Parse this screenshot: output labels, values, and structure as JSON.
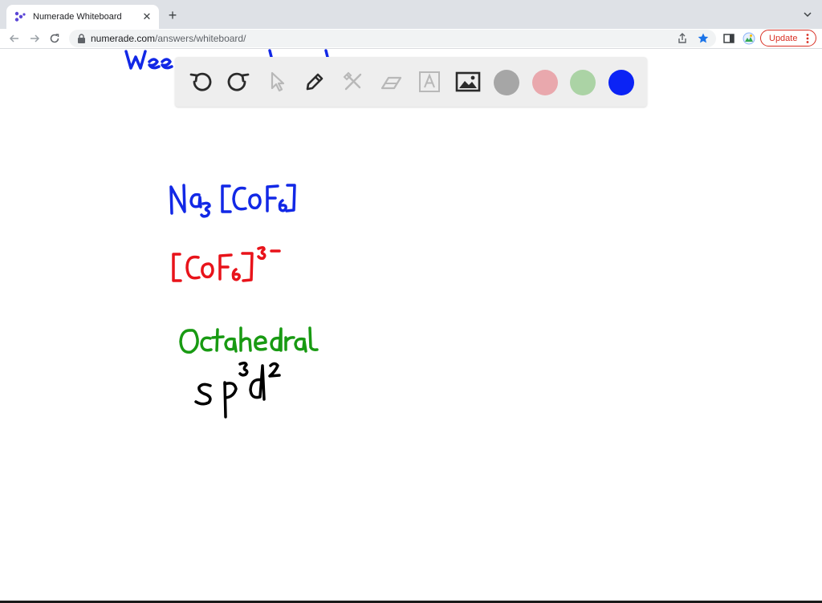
{
  "browser": {
    "tab": {
      "title": "Numerade Whiteboard"
    },
    "url": {
      "host": "numerade.com",
      "path": "/answers/whiteboard/"
    },
    "update_label": "Update"
  },
  "whiteboard": {
    "tools": [
      {
        "name": "undo-icon",
        "enabled": true
      },
      {
        "name": "redo-icon",
        "enabled": true
      },
      {
        "name": "select-pointer-icon",
        "enabled": false
      },
      {
        "name": "pen-icon",
        "enabled": true
      },
      {
        "name": "tools-icon",
        "enabled": false
      },
      {
        "name": "eraser-icon",
        "enabled": false
      },
      {
        "name": "text-icon",
        "enabled": false
      },
      {
        "name": "image-icon",
        "enabled": true
      }
    ],
    "colors": {
      "gray": "#a6a6a6",
      "pink": "#e9a8ad",
      "green": "#abd3a5",
      "blue": "#0b23f5"
    },
    "handwriting": [
      {
        "text": "Na3[CoF6]",
        "color": "#1228e6"
      },
      {
        "text": "[CoF6]3-",
        "color": "#e8131a"
      },
      {
        "text": "Octahedral",
        "color": "#189a12"
      },
      {
        "text": "sp3d2",
        "color": "#000000"
      }
    ]
  }
}
